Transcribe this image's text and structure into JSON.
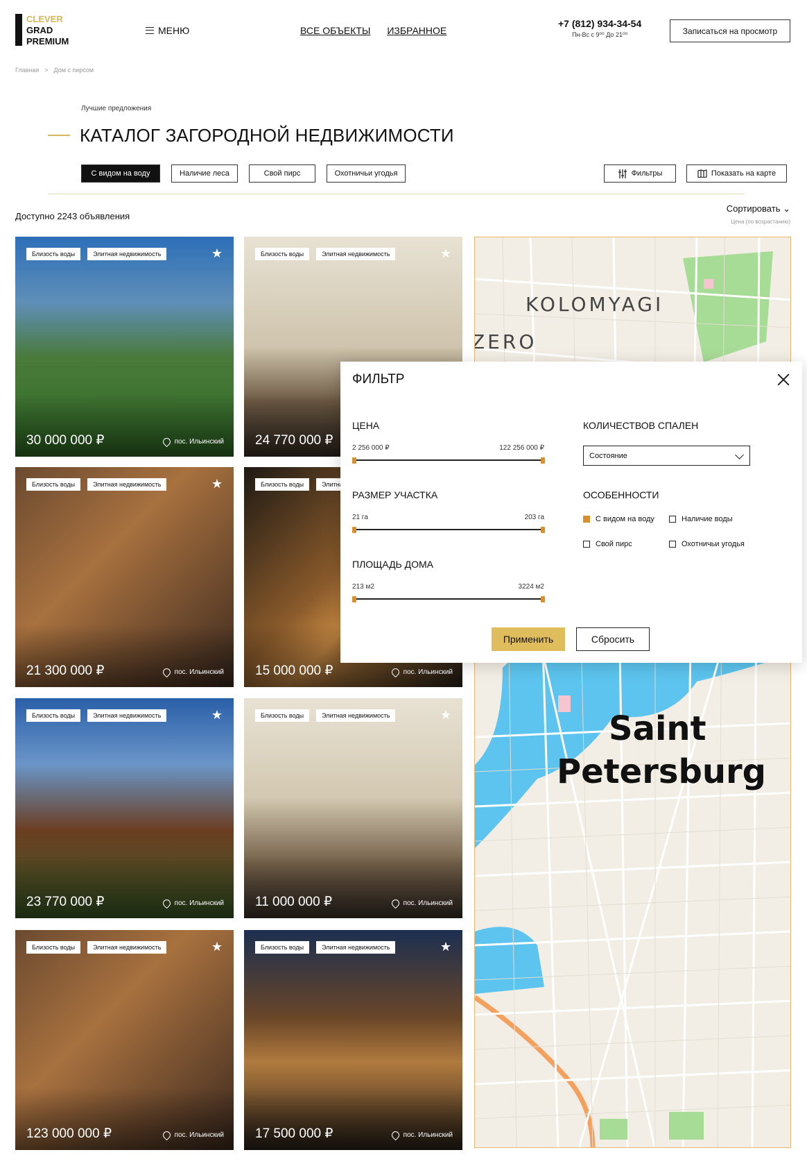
{
  "header": {
    "logo": [
      "CLEVER",
      "GRAD",
      "PREMIUM"
    ],
    "menu_label": "МЕНЮ",
    "nav": [
      "ВСЕ ОБЪЕКТЫ",
      "ИЗБРАННОЕ"
    ],
    "phone": "+7 (812) 934-34-54",
    "hours": "Пн-Вс с 9⁰⁰ До 21⁰⁰",
    "visit_button": "Записаться на просмотр"
  },
  "breadcrumbs": [
    "Главная",
    ">",
    "Дом с пирсом"
  ],
  "subtitle": "Лучшие предложения",
  "title": "КАТАЛОГ ЗАГОРОДНОЙ НЕДВИЖИМОСТИ",
  "chips": [
    "С видом на воду",
    "Наличие леса",
    "Свой пирс",
    "Охотничьи угодья"
  ],
  "tools": {
    "filters": "Фильтры",
    "map": "Показать на карте"
  },
  "available": "Доступно 2243 объявления",
  "sort": {
    "label": "Сортировать",
    "value": "Цена (по возрастанию)"
  },
  "card_tags": [
    "Близость воды",
    "Элитная недвижимость"
  ],
  "cards": [
    {
      "price": "30 000 000 ₽",
      "location": "пос. Ильинский"
    },
    {
      "price": "24 770 000 ₽",
      "location": "пос. Ильинский"
    },
    {
      "price": "21 300 000 ₽",
      "location": "пос. Ильинский"
    },
    {
      "price": "15 000 000 ₽",
      "location": "пос. Ильинский"
    },
    {
      "price": "23 770 000 ₽",
      "location": "пос. Ильинский"
    },
    {
      "price": "11 000 000 ₽",
      "location": "пос. Ильинский"
    },
    {
      "price": "123 000 000 ₽",
      "location": "пос. Ильинский"
    },
    {
      "price": "17 500 000 ₽",
      "location": "пос. Ильинский"
    }
  ],
  "map": {
    "labels": [
      "KOLOMYAGI",
      "ZERO",
      "Saint",
      "Petersburg"
    ]
  },
  "filter": {
    "title": "ФИЛЬТР",
    "price": {
      "label": "ЦЕНА",
      "min": "2 256 000 ₽",
      "max": "122 256 000 ₽"
    },
    "plot": {
      "label": "РАЗМЕР УЧАСТКА",
      "min": "21 га",
      "max": "203 га"
    },
    "house": {
      "label": "ПЛОЩАДЬ ДОМА",
      "min": "213 м2",
      "max": "3224 м2"
    },
    "bedrooms": {
      "label": "КОЛИЧЕСТВОВ СПАЛЕН",
      "placeholder": "Состояние"
    },
    "features": {
      "label": "ОСОБЕННОСТИ",
      "items": [
        {
          "label": "С видом на воду",
          "checked": true
        },
        {
          "label": "Наличие воды",
          "checked": false
        },
        {
          "label": "Свой пирс",
          "checked": false
        },
        {
          "label": "Охотничьи угодья",
          "checked": false
        }
      ]
    },
    "apply": "Применить",
    "reset": "Сбросить"
  }
}
